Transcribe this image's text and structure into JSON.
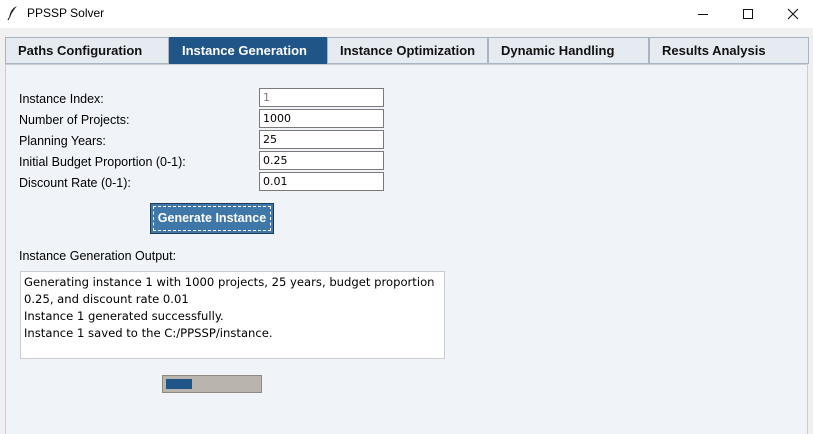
{
  "window": {
    "title": "PPSSP Solver",
    "icon": "feather-pen-icon"
  },
  "tabs": [
    {
      "label": "Paths Configuration"
    },
    {
      "label": "Instance Generation",
      "active": true
    },
    {
      "label": "Instance Optimization"
    },
    {
      "label": "Dynamic Handling"
    },
    {
      "label": "Results Analysis"
    }
  ],
  "form": {
    "fields": [
      {
        "label": "Instance Index:",
        "value": "1"
      },
      {
        "label": "Number of Projects:",
        "value": "1000"
      },
      {
        "label": "Planning Years:",
        "value": "25"
      },
      {
        "label": "Initial Budget Proportion (0-1):",
        "value": "0.25"
      },
      {
        "label": "Discount Rate (0-1):",
        "value": "0.01"
      }
    ],
    "generate_button": "Generate Instance"
  },
  "output": {
    "label": "Instance Generation Output:",
    "text": "Generating instance 1 with 1000 projects, 25 years, budget proportion\n0.25, and discount rate 0.01\nInstance 1 generated successfully.\nInstance 1 saved to the C:/PPSSP/instance."
  },
  "progress": {
    "fraction": 0.28
  },
  "colors": {
    "accent": "#1f5587",
    "button": "#3f78a8",
    "progress_track": "#b9b5ae"
  }
}
